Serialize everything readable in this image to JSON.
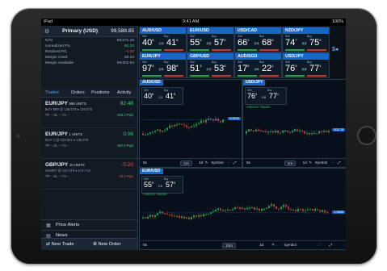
{
  "status_bar": {
    "left": "iPad",
    "time": "9:41 AM",
    "battery": "100%"
  },
  "account": {
    "name": "Primary (USD)",
    "balance": "99,588.85"
  },
  "summary": [
    {
      "label": "NAV",
      "value": "99,671.18",
      "color": "#9fb0c3"
    },
    {
      "label": "Unrealized P/L",
      "value": "82.33",
      "color": "#3ad07a"
    },
    {
      "label": "Realized P/L",
      "value": "-0.00",
      "color": "#e05555"
    },
    {
      "label": "Margin Used",
      "value": "60.44",
      "color": "#9fb0c3"
    },
    {
      "label": "Margin Available",
      "value": "99,602.54",
      "color": "#9fb0c3"
    }
  ],
  "tabs": [
    "Trades",
    "Orders",
    "Positions",
    "Activity"
  ],
  "trades": [
    {
      "pair": "EUR/JPY",
      "units": "999 UNITS",
      "line2": "BUY 999 @ 136.575 ▾ 136.575",
      "line3": "TP -- SL -- TS --",
      "pl": "82.48",
      "pips": "840.3 Pips",
      "color": "#3ad07a"
    },
    {
      "pair": "EUR/JPY",
      "units": "1 UNITS",
      "line2": "BUY 1 @ 132.907 ▾ 136.575",
      "line3": "TP -- SL -- TS --",
      "pl": "0.06",
      "pips": "597.5 Pips",
      "color": "#3ad07a"
    },
    {
      "pair": "GBP/JPY",
      "units": "10 UNITS",
      "line2": "SHORT @ 147.570 ▾ 174.714",
      "line3": "TP -- SL -- TS --",
      "pl": "-0.20",
      "pips": "-20.0 Pips",
      "color": "#e05555"
    }
  ],
  "nav": {
    "price_alerts": "Price Alerts",
    "news": "News",
    "new_trade": "New Trade",
    "new_order": "New Order"
  },
  "tiles": [
    {
      "pair": "AUD/USD",
      "sell_big": "40",
      "sell_sup": "5",
      "buy_big": "41",
      "buy_sup": "8",
      "spread": "1.3"
    },
    {
      "pair": "EUR/USD",
      "sell_big": "55",
      "sell_sup": "8",
      "buy_big": "57",
      "buy_sup": "2",
      "spread": "2.5"
    },
    {
      "pair": "USD/CAD",
      "sell_big": "66",
      "sell_sup": "2",
      "buy_big": "68",
      "buy_sup": "5",
      "spread": "2.3"
    },
    {
      "pair": "NZD/JPY",
      "sell_big": "74",
      "sell_sup": "7",
      "buy_big": "75",
      "buy_sup": "0",
      "spread": "3.0"
    },
    {
      "pair": "EUR/JPY",
      "sell_big": "97",
      "sell_sup": "3",
      "buy_big": "98",
      "buy_sup": "8",
      "spread": "2.5"
    },
    {
      "pair": "GBP/USD",
      "sell_big": "51",
      "sell_sup": "3",
      "buy_big": "53",
      "buy_sup": "6",
      "spread": "2.3"
    },
    {
      "pair": "AUD/SGD",
      "sell_big": "17",
      "sell_sup": "5",
      "buy_big": "22",
      "buy_sup": "1",
      "spread": "4.6"
    },
    {
      "pair": "USD/JPY",
      "sell_big": "76",
      "sell_sup": "3",
      "buy_big": "77",
      "buy_sup": "1",
      "spread": "0.8"
    }
  ],
  "charts": [
    {
      "title": "AUD/USD",
      "timeframe": "1m",
      "granularity": "1d",
      "symbol": "Symbol",
      "sell_big": "40",
      "sell_sup": "6",
      "buy_big": "41",
      "buy_sup": "8",
      "spread": "1.3",
      "price_tag": "0.9141"
    },
    {
      "title": "USD/JPY",
      "timeframe": "1m",
      "granularity": "1d",
      "symbol": "Symbol",
      "sell_big": "76",
      "sell_sup": "4",
      "buy_big": "77",
      "buy_sup": "1",
      "spread": "0.8",
      "price_tag": "101.78",
      "creds": "CREDITS TRADES"
    },
    {
      "title": "EUR/USD",
      "timeframe": "10m",
      "granularity": "1d",
      "symbol": "Symbol",
      "sell_big": "55",
      "sell_sup": "8",
      "buy_big": "57",
      "buy_sup": "3",
      "spread": "2.5",
      "price_tag": "1.3656",
      "creds": "CREDITS TRADES"
    }
  ],
  "left_label_5s": "5s",
  "labels": {
    "sell": "Sell",
    "buy": "Buy"
  },
  "colors": {
    "accent": "#1767c8",
    "up": "#1fa34a",
    "down": "#c0392b",
    "bg": "#0a1018"
  }
}
